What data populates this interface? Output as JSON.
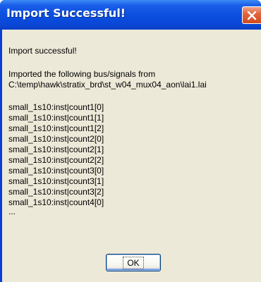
{
  "window": {
    "title": "Import Successful!"
  },
  "message": {
    "heading": "Import successful!",
    "intro_line1": "Imported the following bus/signals from",
    "intro_line2": "C:\\temp\\hawk\\stratix_brd\\st_w04_mux04_aon\\lai1.lai",
    "signals": [
      "small_1s10:inst|count1[0]",
      "small_1s10:inst|count1[1]",
      "small_1s10:inst|count1[2]",
      "small_1s10:inst|count2[0]",
      "small_1s10:inst|count2[1]",
      "small_1s10:inst|count2[2]",
      "small_1s10:inst|count3[0]",
      "small_1s10:inst|count3[1]",
      "small_1s10:inst|count3[2]",
      "small_1s10:inst|count4[0]"
    ],
    "ellipsis": "..."
  },
  "buttons": {
    "ok_label": "OK"
  },
  "icons": {
    "close": "close-icon"
  },
  "colors": {
    "title_bar": "#0a47d6",
    "close_button": "#d14a1e",
    "dialog_face": "#ece9d8"
  }
}
